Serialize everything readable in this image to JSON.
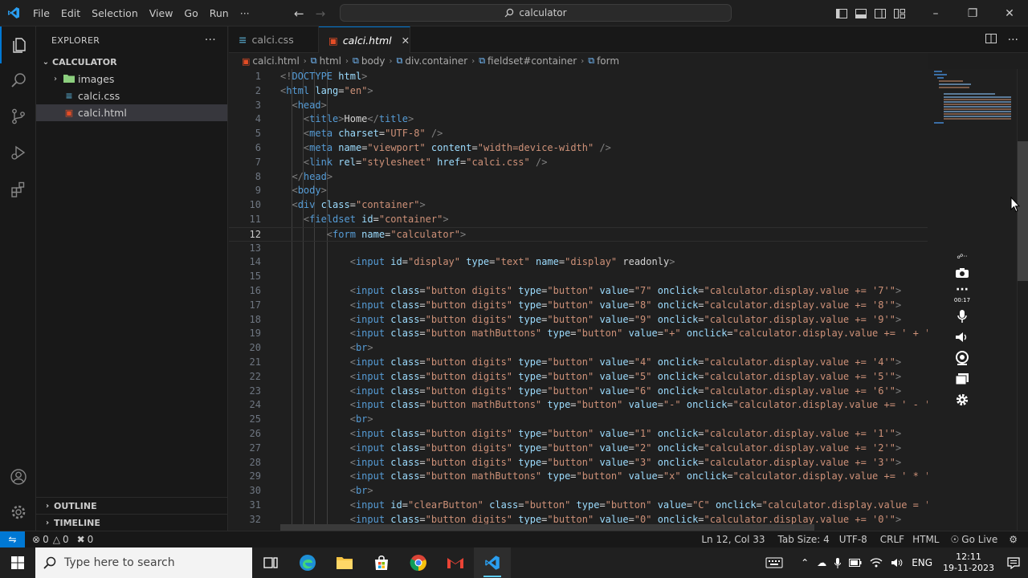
{
  "titlebar": {
    "menu": [
      "File",
      "Edit",
      "Selection",
      "View",
      "Go",
      "Run",
      "···"
    ],
    "search_text": "calculator",
    "nav_back": "←",
    "nav_forward": "→"
  },
  "explorer": {
    "title": "EXPLORER",
    "more": "···",
    "folder": "CALCULATOR",
    "items": [
      {
        "label": "images",
        "type": "folder"
      },
      {
        "label": "calci.css",
        "type": "css"
      },
      {
        "label": "calci.html",
        "type": "html"
      }
    ],
    "outline": "OUTLINE",
    "timeline": "TIMELINE"
  },
  "tabs": [
    {
      "label": "calci.css",
      "type": "css",
      "active": false
    },
    {
      "label": "calci.html",
      "type": "html",
      "active": true
    }
  ],
  "breadcrumb": [
    "calci.html",
    "html",
    "body",
    "div.container",
    "fieldset#container",
    "form"
  ],
  "editor": {
    "current_line": 12,
    "first_line": 1,
    "lines": [
      "<!DOCTYPE html>",
      "<html lang=\"en\">",
      "  <head>",
      "    <title>Home</title>",
      "    <meta charset=\"UTF-8\" />",
      "    <meta name=\"viewport\" content=\"width=device-width\" />",
      "    <link rel=\"stylesheet\" href=\"calci.css\" />",
      "  </head>",
      "  <body>",
      "  <div class=\"container\">",
      "    <fieldset id=\"container\">",
      "        <form name=\"calculator\">",
      "",
      "            <input id=\"display\" type=\"text\" name=\"display\" readonly>",
      "",
      "            <input class=\"button digits\" type=\"button\" value=\"7\" onclick=\"calculator.display.value += '7'\">",
      "            <input class=\"button digits\" type=\"button\" value=\"8\" onclick=\"calculator.display.value += '8'\">",
      "            <input class=\"button digits\" type=\"button\" value=\"9\" onclick=\"calculator.display.value += '9'\">",
      "            <input class=\"button mathButtons\" type=\"button\" value=\"+\" onclick=\"calculator.display.value += ' + '",
      "            <br>",
      "            <input class=\"button digits\" type=\"button\" value=\"4\" onclick=\"calculator.display.value += '4'\">",
      "            <input class=\"button digits\" type=\"button\" value=\"5\" onclick=\"calculator.display.value += '5'\">",
      "            <input class=\"button digits\" type=\"button\" value=\"6\" onclick=\"calculator.display.value += '6'\">",
      "            <input class=\"button mathButtons\" type=\"button\" value=\"-\" onclick=\"calculator.display.value += ' - '",
      "            <br>",
      "            <input class=\"button digits\" type=\"button\" value=\"1\" onclick=\"calculator.display.value += '1'\">",
      "            <input class=\"button digits\" type=\"button\" value=\"2\" onclick=\"calculator.display.value += '2'\">",
      "            <input class=\"button digits\" type=\"button\" value=\"3\" onclick=\"calculator.display.value += '3'\">",
      "            <input class=\"button mathButtons\" type=\"button\" value=\"x\" onclick=\"calculator.display.value += ' * '",
      "            <br>",
      "            <input id=\"clearButton\" class=\"button\" type=\"button\" value=\"C\" onclick=\"calculator.display.value = '",
      "            <input class=\"button digits\" type=\"button\" value=\"0\" onclick=\"calculator.display.value += '0'\">"
    ]
  },
  "recorder": {
    "timer": "00:17"
  },
  "statusbar": {
    "errors": "0",
    "warnings": "0",
    "ports": "0",
    "position": "Ln 12, Col 33",
    "tab_size": "Tab Size: 4",
    "encoding": "UTF-8",
    "eol": "CRLF",
    "language": "HTML",
    "golive": "Go Live"
  },
  "taskbar": {
    "search_placeholder": "Type here to search",
    "language": "ENG",
    "time": "12:11",
    "date": "19-11-2023"
  },
  "colors": {
    "accent": "#0078d4",
    "html_icon": "#e44d26",
    "css_icon": "#519aba"
  }
}
